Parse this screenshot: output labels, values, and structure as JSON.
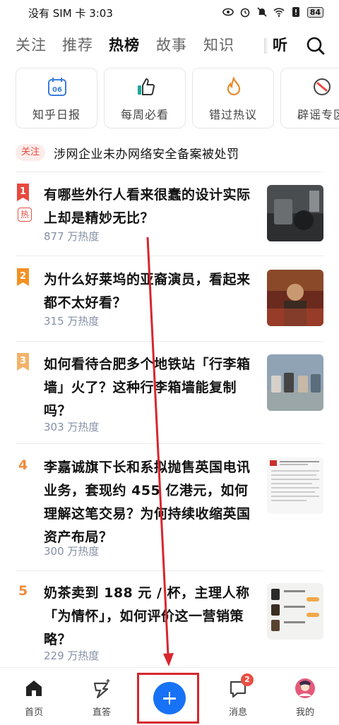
{
  "status_bar": {
    "carrier_time": "没有 SIM 卡 3:03",
    "battery": "84"
  },
  "top_tabs": [
    {
      "label": "关注",
      "active": false
    },
    {
      "label": "推荐",
      "active": false
    },
    {
      "label": "热榜",
      "active": true
    },
    {
      "label": "故事",
      "active": false
    },
    {
      "label": "知识",
      "active": false
    }
  ],
  "listen_tab": "听",
  "quick_cards": [
    {
      "label": "知乎日报",
      "icon": "calendar-icon",
      "date": "06"
    },
    {
      "label": "每周必看",
      "icon": "thumbs-up-icon"
    },
    {
      "label": "错过热议",
      "icon": "flame-icon"
    },
    {
      "label": "辟谣专区",
      "icon": "rumor-icon"
    }
  ],
  "notice": {
    "badge": "关注",
    "text": "涉网企业未办网络安全备案被处罚"
  },
  "hot_list": [
    {
      "rank": "1",
      "hot_tag": "热",
      "title": "有哪些外行人看来很蠢的设计实际上却是精妙无比？",
      "heat": "877 万热度",
      "rank_color": "#e8493f"
    },
    {
      "rank": "2",
      "title": "为什么好莱坞的亚裔演员，看起来都不太好看？",
      "heat": "315 万热度",
      "rank_color": "#f39125"
    },
    {
      "rank": "3",
      "title": "如何看待合肥多个地铁站「行李箱墙」火了？这种行李箱墙能复制吗？",
      "heat": "303 万热度",
      "rank_color": "#f3b36a"
    },
    {
      "rank": "4",
      "title": "李嘉诚旗下长和系拟抛售英国电讯业务，套现约 455 亿港元，如何理解这笔交易？为何持续收缩英国资产布局？",
      "heat": "300 万热度",
      "rank_color": "#f08a3a"
    },
    {
      "rank": "5",
      "title": "奶茶卖到 188 元 / 杯，主理人称「为情怀」，如何评价这一营销策略？",
      "heat": "229 万热度",
      "rank_color": "#f08a3a"
    }
  ],
  "bottom_nav": [
    {
      "label": "首页",
      "icon": "home-icon"
    },
    {
      "label": "直答",
      "icon": "answer-icon"
    },
    {
      "label": "",
      "icon": "plus-icon"
    },
    {
      "label": "消息",
      "icon": "message-icon",
      "badge": "2"
    },
    {
      "label": "我的",
      "icon": "profile-icon"
    }
  ],
  "colors": {
    "accent": "#1772f6",
    "hot": "#e8493f",
    "annotation": "#d8262e"
  }
}
